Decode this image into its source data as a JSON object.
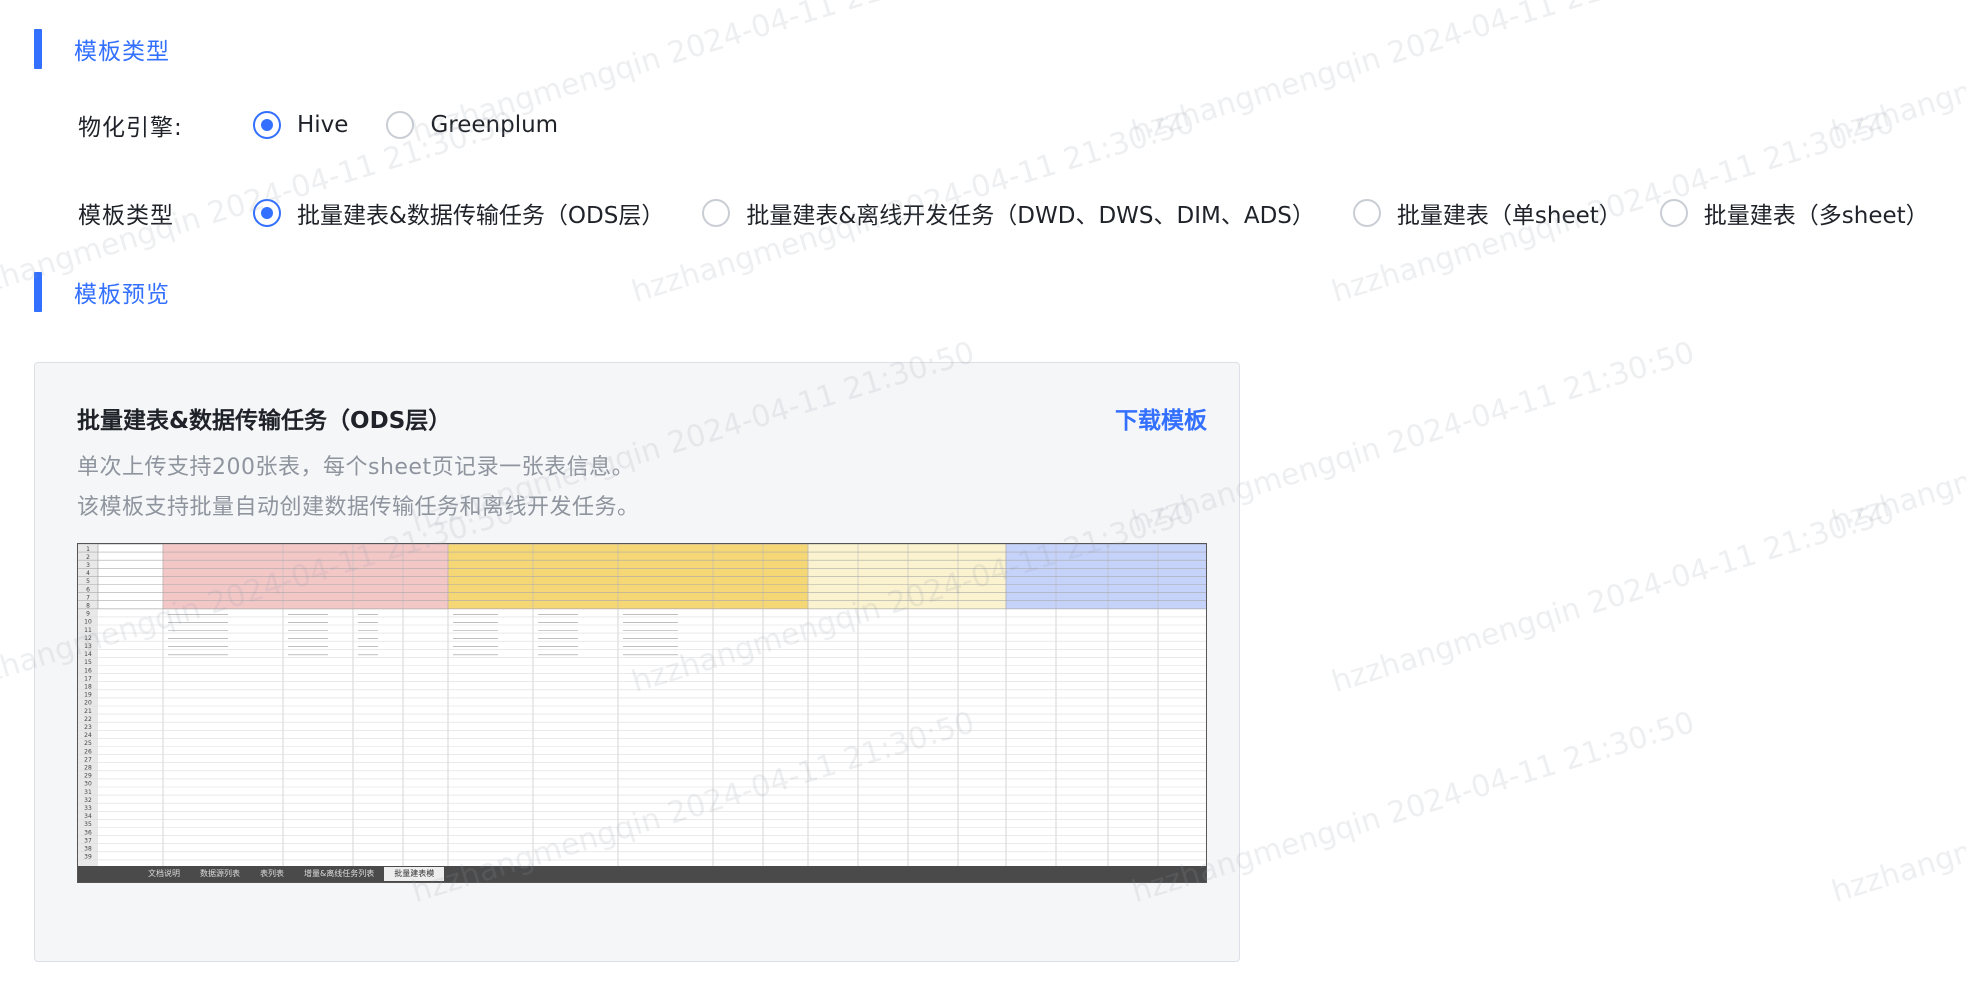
{
  "sections": {
    "template_type_title": "模板类型",
    "template_preview_title": "模板预览"
  },
  "engine": {
    "label": "物化引擎:",
    "options": [
      "Hive",
      "Greenplum"
    ],
    "selected": "Hive"
  },
  "template_type": {
    "label": "模板类型",
    "options": [
      "批量建表&数据传输任务（ODS层）",
      "批量建表&离线开发任务（DWD、DWS、DIM、ADS）",
      "批量建表（单sheet）",
      "批量建表（多sheet）"
    ],
    "selected": "批量建表&数据传输任务（ODS层）"
  },
  "preview": {
    "title": "批量建表&数据传输任务（ODS层）",
    "download_label": "下载模板",
    "desc_line1": "单次上传支持200张表，每个sheet页记录一张表信息。",
    "desc_line2": "该模板支持批量自动创建数据传输任务和离线开发任务。",
    "sheet": {
      "row_numbers": [
        "1",
        "2",
        "3",
        "4",
        "5",
        "6",
        "7",
        "8",
        "9",
        "10",
        "11",
        "12",
        "13",
        "14",
        "15",
        "16",
        "17",
        "18",
        "19",
        "20",
        "21",
        "22",
        "23",
        "24",
        "25",
        "26",
        "27",
        "28",
        "29",
        "30",
        "31",
        "32",
        "33",
        "34",
        "35",
        "36",
        "37",
        "38",
        "39"
      ],
      "tabs": [
        "文档说明",
        "数据源列表",
        "表列表",
        "增量&离线任务列表",
        "批量建表模"
      ],
      "active_tab": "批量建表模"
    }
  },
  "watermark_text": "hzzhangmengqin 2024-04-11 21:30:50",
  "colors": {
    "accent": "#3370ff",
    "sheet_pink": "#f4c7c7",
    "sheet_yellow": "#f6d776",
    "sheet_cream": "#fbf3cf",
    "sheet_blue": "#c5d3fb"
  }
}
